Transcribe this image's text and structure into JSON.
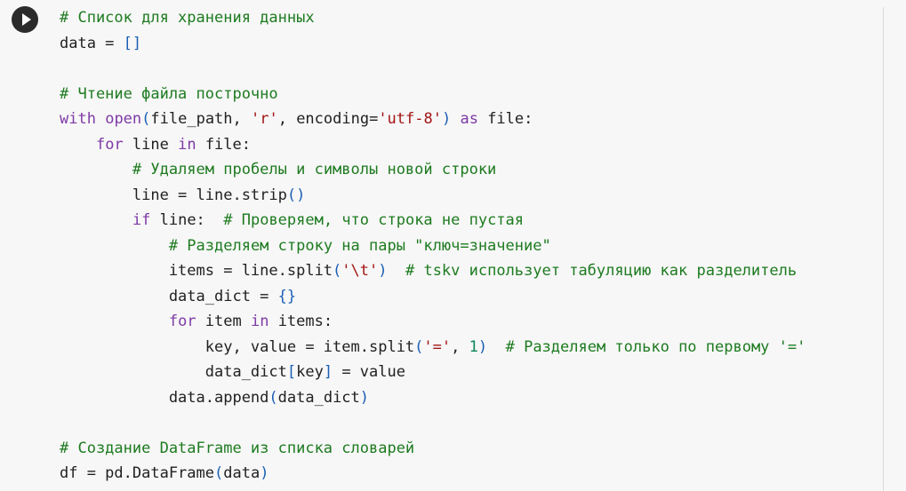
{
  "cell": {
    "run_button_icon": "play-icon",
    "lines": [
      "# Список для хранения данных",
      "data = []",
      "",
      "# Чтение файла построчно",
      "with open(file_path, 'r', encoding='utf-8') as file:",
      "    for line in file:",
      "        # Удаляем пробелы и символы новой строки",
      "        line = line.strip()",
      "        if line:  # Проверяем, что строка не пустая",
      "            # Разделяем строку на пары \"ключ=значение\"",
      "            items = line.split('\\t')  # tskv использует табуляцию как разделитель",
      "            data_dict = {}",
      "            for item in items:",
      "                key, value = item.split('=', 1)  # Разделяем только по первому '='",
      "                data_dict[key] = value",
      "            data.append(data_dict)",
      "",
      "# Создание DataFrame из списка словарей",
      "df = pd.DataFrame(data)"
    ]
  },
  "colors": {
    "background": "#f7f7f7",
    "keyword": "#7e3aa6",
    "string": "#a31515",
    "number": "#098658",
    "comment": "#1e7b20",
    "bracket": "#1a5fb4",
    "text": "#212121"
  }
}
